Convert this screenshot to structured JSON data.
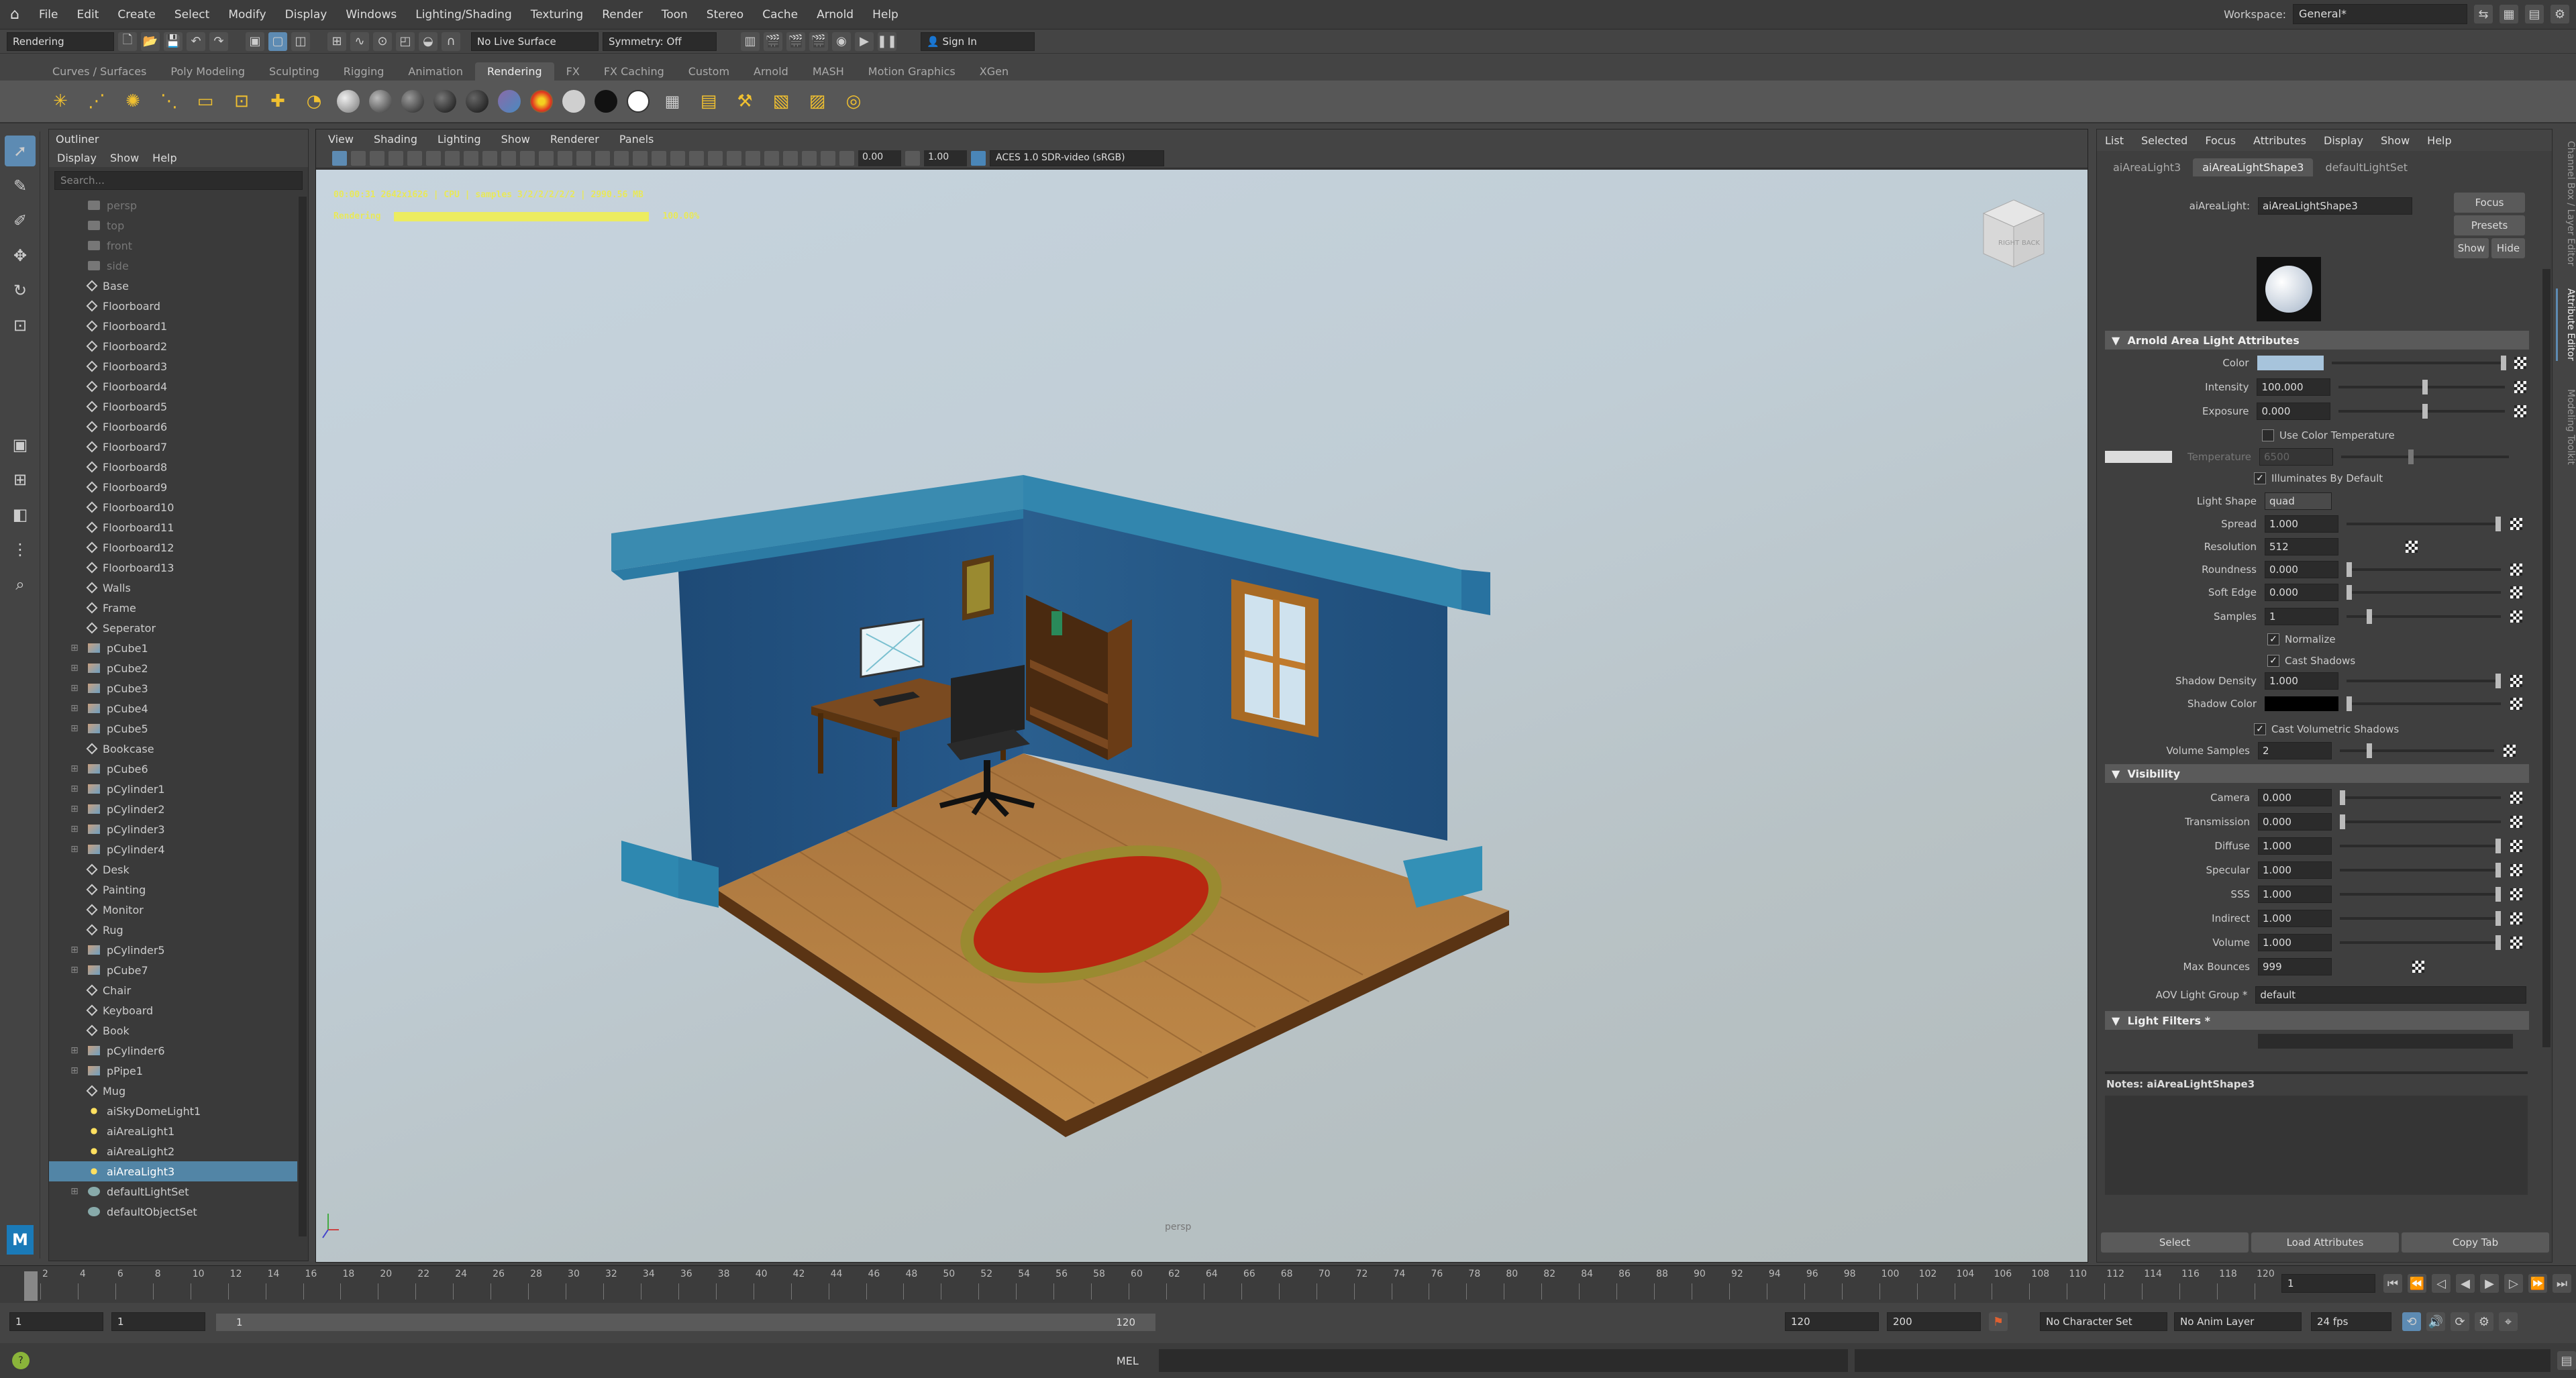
{
  "menubar": {
    "items": [
      "File",
      "Edit",
      "Create",
      "Select",
      "Modify",
      "Display",
      "Windows",
      "Lighting/Shading",
      "Texturing",
      "Render",
      "Toon",
      "Stereo",
      "Cache",
      "Arnold",
      "Help"
    ],
    "workspace_label": "Workspace:",
    "workspace_value": "General*"
  },
  "statusline": {
    "menuset": "Rendering",
    "live_surface": "No Live Surface",
    "symmetry": "Symmetry: Off",
    "sign_in": "Sign In"
  },
  "shelf": {
    "tabs": [
      "Curves / Surfaces",
      "Poly Modeling",
      "Sculpting",
      "Rigging",
      "Animation",
      "Rendering",
      "FX",
      "FX Caching",
      "Custom",
      "Arnold",
      "MASH",
      "Motion Graphics",
      "XGen"
    ],
    "active_tab": "Rendering"
  },
  "outliner": {
    "title": "Outliner",
    "menu": [
      "Display",
      "Show",
      "Help"
    ],
    "search_placeholder": "Search...",
    "items": [
      {
        "label": "persp",
        "type": "camera",
        "dim": true,
        "exp": false
      },
      {
        "label": "top",
        "type": "camera",
        "dim": true,
        "exp": false
      },
      {
        "label": "front",
        "type": "camera",
        "dim": true,
        "exp": false
      },
      {
        "label": "side",
        "type": "camera",
        "dim": true,
        "exp": false
      },
      {
        "label": "Base",
        "type": "group",
        "exp": false
      },
      {
        "label": "Floorboard",
        "type": "group",
        "exp": false
      },
      {
        "label": "Floorboard1",
        "type": "group",
        "exp": false
      },
      {
        "label": "Floorboard2",
        "type": "group",
        "exp": false
      },
      {
        "label": "Floorboard3",
        "type": "group",
        "exp": false
      },
      {
        "label": "Floorboard4",
        "type": "group",
        "exp": false
      },
      {
        "label": "Floorboard5",
        "type": "group",
        "exp": false
      },
      {
        "label": "Floorboard6",
        "type": "group",
        "exp": false
      },
      {
        "label": "Floorboard7",
        "type": "group",
        "exp": false
      },
      {
        "label": "Floorboard8",
        "type": "group",
        "exp": false
      },
      {
        "label": "Floorboard9",
        "type": "group",
        "exp": false
      },
      {
        "label": "Floorboard10",
        "type": "group",
        "exp": false
      },
      {
        "label": "Floorboard11",
        "type": "group",
        "exp": false
      },
      {
        "label": "Floorboard12",
        "type": "group",
        "exp": false
      },
      {
        "label": "Floorboard13",
        "type": "group",
        "exp": false
      },
      {
        "label": "Walls",
        "type": "group",
        "exp": false
      },
      {
        "label": "Frame",
        "type": "group",
        "exp": false
      },
      {
        "label": "Seperator",
        "type": "group",
        "exp": false
      },
      {
        "label": "pCube1",
        "type": "mesh",
        "exp": true
      },
      {
        "label": "pCube2",
        "type": "mesh",
        "exp": true
      },
      {
        "label": "pCube3",
        "type": "mesh",
        "exp": true
      },
      {
        "label": "pCube4",
        "type": "mesh",
        "exp": true
      },
      {
        "label": "pCube5",
        "type": "mesh",
        "exp": true
      },
      {
        "label": "Bookcase",
        "type": "group",
        "exp": false
      },
      {
        "label": "pCube6",
        "type": "mesh",
        "exp": true
      },
      {
        "label": "pCylinder1",
        "type": "mesh",
        "exp": true
      },
      {
        "label": "pCylinder2",
        "type": "mesh",
        "exp": true
      },
      {
        "label": "pCylinder3",
        "type": "mesh",
        "exp": true
      },
      {
        "label": "pCylinder4",
        "type": "mesh",
        "exp": true
      },
      {
        "label": "Desk",
        "type": "group",
        "exp": false
      },
      {
        "label": "Painting",
        "type": "group",
        "exp": false
      },
      {
        "label": "Monitor",
        "type": "group",
        "exp": false
      },
      {
        "label": "Rug",
        "type": "group",
        "exp": false
      },
      {
        "label": "pCylinder5",
        "type": "mesh",
        "exp": true
      },
      {
        "label": "pCube7",
        "type": "mesh",
        "exp": true
      },
      {
        "label": "Chair",
        "type": "group",
        "exp": false
      },
      {
        "label": "Keyboard",
        "type": "group",
        "exp": false
      },
      {
        "label": "Book",
        "type": "group",
        "exp": false
      },
      {
        "label": "pCylinder6",
        "type": "mesh",
        "exp": true
      },
      {
        "label": "pPipe1",
        "type": "mesh",
        "exp": true
      },
      {
        "label": "Mug",
        "type": "group",
        "exp": false
      },
      {
        "label": "aiSkyDomeLight1",
        "type": "light",
        "exp": false
      },
      {
        "label": "aiAreaLight1",
        "type": "light",
        "exp": false
      },
      {
        "label": "aiAreaLight2",
        "type": "light",
        "exp": false
      },
      {
        "label": "aiAreaLight3",
        "type": "light",
        "exp": false,
        "selected": true
      },
      {
        "label": "defaultLightSet",
        "type": "set",
        "exp": true
      },
      {
        "label": "defaultObjectSet",
        "type": "set",
        "exp": false
      }
    ]
  },
  "viewport": {
    "menu": [
      "View",
      "Shading",
      "Lighting",
      "Show",
      "Renderer",
      "Panels"
    ],
    "exposure": "0.00",
    "gamma": "1.00",
    "colorspace": "ACES 1.0 SDR-video (sRGB)",
    "hud_line1": "00:00:31  2642x1626  |  CPU  |  samples 3/2/2/2/2/2  |  2990.56 MB",
    "hud_line2_label": "Rendering",
    "hud_line2_pct": "100.00%",
    "render_progress": 1.0,
    "camera_label": "persp",
    "viewcube_left": "RIGHT",
    "viewcube_right": "BACK"
  },
  "attribute_editor": {
    "menu": [
      "List",
      "Selected",
      "Focus",
      "Attributes",
      "Display",
      "Show",
      "Help"
    ],
    "tabs": [
      "aiAreaLight3",
      "aiAreaLightShape3",
      "defaultLightSet"
    ],
    "active_tab": "aiAreaLightShape3",
    "node_label": "aiAreaLight:",
    "node_value": "aiAreaLightShape3",
    "buttons": {
      "focus": "Focus",
      "presets": "Presets",
      "show": "Show",
      "hide": "Hide"
    },
    "section1": "Arnold Area Light Attributes",
    "color_label": "Color",
    "light_color": "#a7c4dc",
    "intensity_label": "Intensity",
    "intensity": "100.000",
    "exposure_label": "Exposure",
    "exposure": "0.000",
    "use_color_temp": "Use Color Temperature",
    "temperature_label": "Temperature",
    "temperature": "6500",
    "illuminates": "Illuminates By Default",
    "light_shape_label": "Light Shape",
    "light_shape": "quad",
    "spread_label": "Spread",
    "spread": "1.000",
    "resolution_label": "Resolution",
    "resolution": "512",
    "roundness_label": "Roundness",
    "roundness": "0.000",
    "soft_edge_label": "Soft Edge",
    "soft_edge": "0.000",
    "samples_label": "Samples",
    "samples": "1",
    "normalize": "Normalize",
    "cast_shadows": "Cast Shadows",
    "shadow_density_label": "Shadow Density",
    "shadow_density": "1.000",
    "shadow_color_label": "Shadow Color",
    "cast_volumetric": "Cast Volumetric Shadows",
    "volume_samples_label": "Volume Samples",
    "volume_samples": "2",
    "section2": "Visibility",
    "camera_label": "Camera",
    "camera": "0.000",
    "transmission_label": "Transmission",
    "transmission": "0.000",
    "diffuse_label": "Diffuse",
    "diffuse": "1.000",
    "specular_label": "Specular",
    "specular": "1.000",
    "sss_label": "SSS",
    "sss": "1.000",
    "indirect_label": "Indirect",
    "indirect": "1.000",
    "volume_label": "Volume",
    "volume": "1.000",
    "max_bounces_label": "Max Bounces",
    "max_bounces": "999",
    "aov_label": "AOV Light Group *",
    "aov": "default",
    "section3": "Light Filters *",
    "notes": "Notes:  aiAreaLightShape3",
    "bottom_buttons": [
      "Select",
      "Load Attributes",
      "Copy Tab"
    ]
  },
  "timeline": {
    "ticks": [
      "2",
      "4",
      "6",
      "8",
      "10",
      "12",
      "14",
      "16",
      "18",
      "20",
      "22",
      "24",
      "26",
      "28",
      "30",
      "32",
      "34",
      "36",
      "38",
      "40",
      "42",
      "44",
      "46",
      "48",
      "50",
      "52",
      "54",
      "56",
      "58",
      "60",
      "62",
      "64",
      "66",
      "68",
      "70",
      "72",
      "74",
      "76",
      "78",
      "80",
      "82",
      "84",
      "86",
      "88",
      "90",
      "92",
      "94",
      "96",
      "98",
      "100",
      "102",
      "104",
      "106",
      "108",
      "110",
      "112",
      "114",
      "116",
      "118",
      "120"
    ],
    "current_frame": "1",
    "range_start": "1",
    "range_start2": "1",
    "range_inner_start": "1",
    "range_inner_end": "120",
    "range_end": "120",
    "range_end2": "200",
    "character_set": "No Character Set",
    "anim_layer": "No Anim Layer",
    "fps": "24 fps"
  },
  "cmdline": {
    "label": "MEL"
  },
  "side_tabs": [
    "Channel Box / Layer Editor",
    "Attribute Editor",
    "Modeling Toolkit"
  ]
}
